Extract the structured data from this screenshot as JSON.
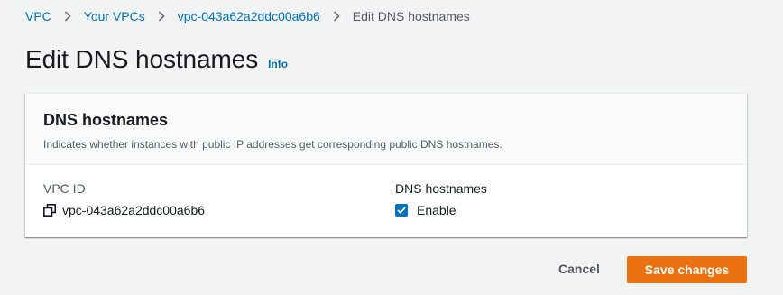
{
  "breadcrumb": {
    "items": [
      {
        "label": "VPC"
      },
      {
        "label": "Your VPCs"
      },
      {
        "label": "vpc-043a62a2ddc00a6b6"
      }
    ],
    "current": "Edit DNS hostnames"
  },
  "page": {
    "title": "Edit DNS hostnames",
    "info_label": "Info"
  },
  "panel": {
    "title": "DNS hostnames",
    "description": "Indicates whether instances with public IP addresses get corresponding public DNS hostnames.",
    "vpc_id": {
      "label": "VPC ID",
      "value": "vpc-043a62a2ddc00a6b6",
      "icon": "copy-icon"
    },
    "dns_hostnames": {
      "label": "DNS hostnames",
      "checkbox_label": "Enable",
      "checked": true
    }
  },
  "actions": {
    "cancel_label": "Cancel",
    "save_label": "Save changes"
  },
  "colors": {
    "background": "#f2f3f3",
    "link": "#0073bb",
    "primary_button": "#ec7211",
    "checkbox": "#0073bb",
    "text": "#16191f",
    "secondary_text": "#545b64"
  }
}
